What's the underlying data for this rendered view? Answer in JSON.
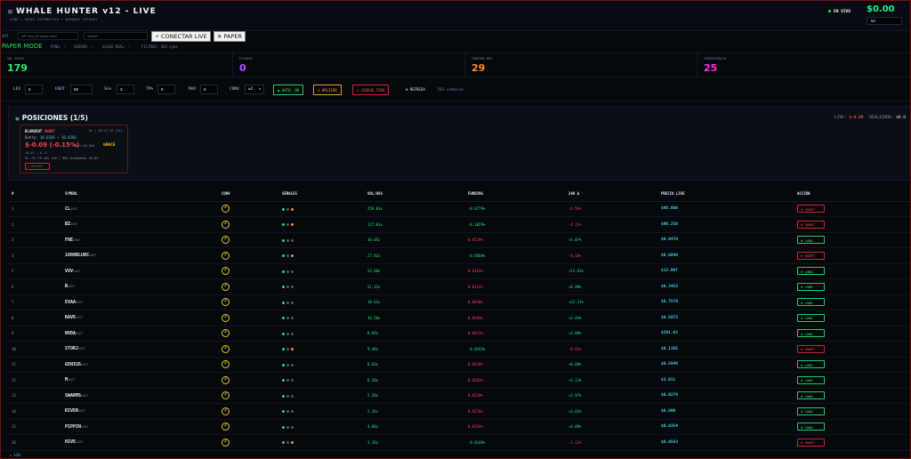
{
  "header": {
    "title": "WHALE HUNTER v12 - LIVE",
    "subtitle": "LONG + SHORT AUTOMATICO • BINANCE FUTURES",
    "live_status": "EN VIVO",
    "balance": "$0.00",
    "balance_input": "50"
  },
  "api": {
    "label": "API",
    "key_placeholder": "API Key (Futures read",
    "secret_placeholder": "Secret",
    "connect_button": "⚡ CONECTAR LIVE",
    "paper_button": "✕ PAPER"
  },
  "mode": {
    "label": "PAPER MODE",
    "ping": "PING: –",
    "server": "SERVER: –",
    "saldo": "SALDO REAL: –",
    "filters": "FILTROS: 583 syms"
  },
  "stats": [
    {
      "label": "VOL SPIKE",
      "value": "179",
      "color": "#22ee77"
    },
    {
      "label": "FUTUROS",
      "value": "0",
      "color": "#b04cff"
    },
    {
      "label": "FUNDING NEG",
      "value": "29",
      "color": "#ff8a1a"
    },
    {
      "label": "CONVERGENCIA",
      "value": "25",
      "color": "#ff2fd8"
    }
  ],
  "controls": {
    "lev_label": "LEV",
    "lev": "5",
    "usdt_label": "USDT",
    "usdt": "50",
    "sl_label": "SL%",
    "sl": "3",
    "tp_label": "TP%",
    "tp": "8",
    "max_label": "MAX",
    "max": "5",
    "conv_label": "CONV",
    "conv": "≥2",
    "auto_button": "AUTO: ON",
    "apply_button": "APLICAR",
    "close_all_button": "CERRAR TODO",
    "refresh_button": "REFRESH",
    "symbols_count": "583 símbolos"
  },
  "positions": {
    "title": "POSICIONES (1/5)",
    "live_label": "LIVE:",
    "live_value": "$-0.09",
    "realized_label": "REALIZADO:",
    "realized_value": "$0.0",
    "card": {
      "symbol": "BLURUSDT",
      "side": "SHORT",
      "meta": "5x | 05:47:10 [0s]",
      "entry_label": "Entry:",
      "entry": "10.0266 → 10.0266",
      "pnl": "$-0.09 (-0.15%)",
      "peak": "Pico:$0.000",
      "grace": "GRACE",
      "range": "10.0% → 0.1%",
      "sl_tp": "SL:-3% TP:+8% 150 | 902 breakeven 20.0%",
      "cerrar": "✕ Cerrar"
    }
  },
  "table": {
    "headers": [
      "#",
      "SYMBOL",
      "CONV",
      "SEÑALES",
      "VOL/AVG",
      "FUNDING",
      "24H Δ",
      "PRECIO LIVE",
      "ACCIÓN"
    ],
    "rows": [
      {
        "n": "1",
        "sym": "CL",
        "conv": "2",
        "sig": [
          "green",
          "gray",
          "orange"
        ],
        "vol": "259.83x",
        "funding": "-0.0779%",
        "fclass": "pos",
        "chg": "-6.56%",
        "cclass": "neg",
        "price": "$98.000",
        "action": "⊕ SHORT",
        "aclass": "short"
      },
      {
        "n": "2",
        "sym": "BZ",
        "conv": "2",
        "sig": [
          "green",
          "gray",
          "orange"
        ],
        "vol": "127.01x",
        "funding": "-0.1029%",
        "fclass": "pos",
        "chg": "-4.21%",
        "cclass": "neg",
        "price": "$96.250",
        "action": "⊕ SHORT",
        "aclass": "short"
      },
      {
        "n": "3",
        "sym": "FHE",
        "conv": "2",
        "sig": [
          "green",
          "gray",
          "gray"
        ],
        "vol": "30.05x",
        "funding": "0.0139%",
        "fclass": "neg",
        "chg": "+5.87%",
        "cclass": "pos",
        "price": "$0.0470",
        "action": "⊕ LONG",
        "aclass": "long"
      },
      {
        "n": "4",
        "sym": "1000BLUNC",
        "conv": "2",
        "sig": [
          "green",
          "gray",
          "orange"
        ],
        "vol": "27.92x",
        "funding": "-0.0588%",
        "fclass": "pos",
        "chg": "-0.10%",
        "cclass": "neg",
        "price": "$0.0890",
        "action": "⊕ SHORT",
        "aclass": "short"
      },
      {
        "n": "5",
        "sym": "VVV",
        "conv": "2",
        "sig": [
          "green",
          "gray",
          "gray"
        ],
        "vol": "22.68x",
        "funding": "0.0101%",
        "fclass": "neg",
        "chg": "+13.61%",
        "cclass": "pos",
        "price": "$12.007",
        "action": "⊕ LONG",
        "aclass": "long"
      },
      {
        "n": "6",
        "sym": "B",
        "conv": "2",
        "sig": [
          "green",
          "gray",
          "gray"
        ],
        "vol": "21.33x",
        "funding": "0.0112%",
        "fclass": "neg",
        "chg": "+6.98%",
        "cclass": "pos",
        "price": "$0.3453",
        "action": "⊕ LONG",
        "aclass": "long"
      },
      {
        "n": "7",
        "sym": "EVAA",
        "conv": "2",
        "sig": [
          "green",
          "gray",
          "gray"
        ],
        "vol": "18.61x",
        "funding": "0.0618%",
        "fclass": "neg",
        "chg": "+22.21%",
        "cclass": "pos",
        "price": "$0.7570",
        "action": "⊕ LONG",
        "aclass": "long"
      },
      {
        "n": "8",
        "sym": "RAVE",
        "conv": "2",
        "sig": [
          "green",
          "gray",
          "gray"
        ],
        "vol": "16.58x",
        "funding": "0.0284%",
        "fclass": "neg",
        "chg": "+2.44%",
        "cclass": "pos",
        "price": "$0.5073",
        "action": "⊕ LONG",
        "aclass": "long"
      },
      {
        "n": "9",
        "sym": "NVDA",
        "conv": "2",
        "sig": [
          "green",
          "gray",
          "gray"
        ],
        "vol": "8.69x",
        "funding": "0.0611%",
        "fclass": "neg",
        "chg": "+3.00%",
        "cclass": "pos",
        "price": "$201.03",
        "action": "⊕ LONG",
        "aclass": "long"
      },
      {
        "n": "10",
        "sym": "STORJ",
        "conv": "2",
        "sig": [
          "green",
          "gray",
          "orange"
        ],
        "vol": "9.49x",
        "funding": "-0.0193%",
        "fclass": "pos",
        "chg": "-0.01%",
        "cclass": "neg",
        "price": "$0.1165",
        "action": "⊕ SHORT",
        "aclass": "short"
      },
      {
        "n": "11",
        "sym": "GENIUS",
        "conv": "2",
        "sig": [
          "green",
          "gray",
          "gray"
        ],
        "vol": "8.83x",
        "funding": "0.0639%",
        "fclass": "neg",
        "chg": "+0.08%",
        "cclass": "pos",
        "price": "$0.5949",
        "action": "⊕ LONG",
        "aclass": "long"
      },
      {
        "n": "12",
        "sym": "M",
        "conv": "2",
        "sig": [
          "green",
          "gray",
          "gray"
        ],
        "vol": "6.58x",
        "funding": "0.0283%",
        "fclass": "neg",
        "chg": "+5.13%",
        "cclass": "pos",
        "price": "$3.011",
        "action": "⊕ LONG",
        "aclass": "long"
      },
      {
        "n": "13",
        "sym": "SWARMS",
        "conv": "2",
        "sig": [
          "green",
          "gray",
          "gray"
        ],
        "vol": "5.58x",
        "funding": "0.0529%",
        "fclass": "neg",
        "chg": "+2.97%",
        "cclass": "pos",
        "price": "$0.0279",
        "action": "⊕ LONG",
        "aclass": "long"
      },
      {
        "n": "14",
        "sym": "RIVER",
        "conv": "2",
        "sig": [
          "green",
          "gray",
          "gray"
        ],
        "vol": "5.34x",
        "funding": "0.0276%",
        "fclass": "neg",
        "chg": "+2.02%",
        "cclass": "pos",
        "price": "$6.090",
        "action": "⊕ LONG",
        "aclass": "long"
      },
      {
        "n": "15",
        "sym": "PIPPIN",
        "conv": "2",
        "sig": [
          "green",
          "gray",
          "gray"
        ],
        "vol": "4.88x",
        "funding": "0.0316%",
        "fclass": "neg",
        "chg": "+4.09%",
        "cclass": "pos",
        "price": "$0.0354",
        "action": "⊕ LONG",
        "aclass": "long"
      },
      {
        "n": "16",
        "sym": "HIVE",
        "conv": "2",
        "sig": [
          "green",
          "gray",
          "orange"
        ],
        "vol": "3.18x",
        "funding": "-0.0140%",
        "fclass": "pos",
        "chg": "-1.12%",
        "cclass": "neg",
        "price": "$0.0563",
        "action": "⊕ SHORT",
        "aclass": "short"
      }
    ]
  },
  "footer": {
    "log_label": "LOG"
  }
}
